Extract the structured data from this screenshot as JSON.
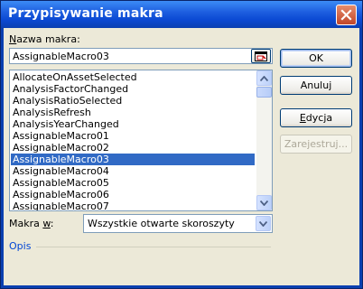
{
  "window": {
    "title": "Przypisywanie makra"
  },
  "macro_name": {
    "label_hotkey": "N",
    "label_rest": "azwa makra:",
    "value": "AssignableMacro03"
  },
  "macros": [
    "AllocateOnAssetSelected",
    "AnalysisFactorChanged",
    "AnalysisRatioSelected",
    "AnalysisRefresh",
    "AnalysisYearChanged",
    "AssignableMacro01",
    "AssignableMacro02",
    "AssignableMacro03",
    "AssignableMacro04",
    "AssignableMacro05",
    "AssignableMacro06",
    "AssignableMacro07"
  ],
  "selected_macro": "AssignableMacro03",
  "buttons": {
    "ok": "OK",
    "cancel": "Anuluj",
    "edit_hotkey": "E",
    "edit_rest": "dycja",
    "record": "Zarejestruj..."
  },
  "macros_in": {
    "label_hotkey": "w",
    "label_prefix": "Makra ",
    "label_suffix": ":",
    "value": "Wszystkie otwarte skoroszyty"
  },
  "description": {
    "label": "Opis"
  },
  "colors": {
    "title_bar": "#0B49D3",
    "selection": "#316AC5",
    "dialog_bg": "#ECE9D8",
    "close": "#C0462A"
  },
  "icons": [
    "close-icon",
    "collapse-dialog-icon",
    "arrow-up-icon",
    "arrow-down-icon"
  ]
}
